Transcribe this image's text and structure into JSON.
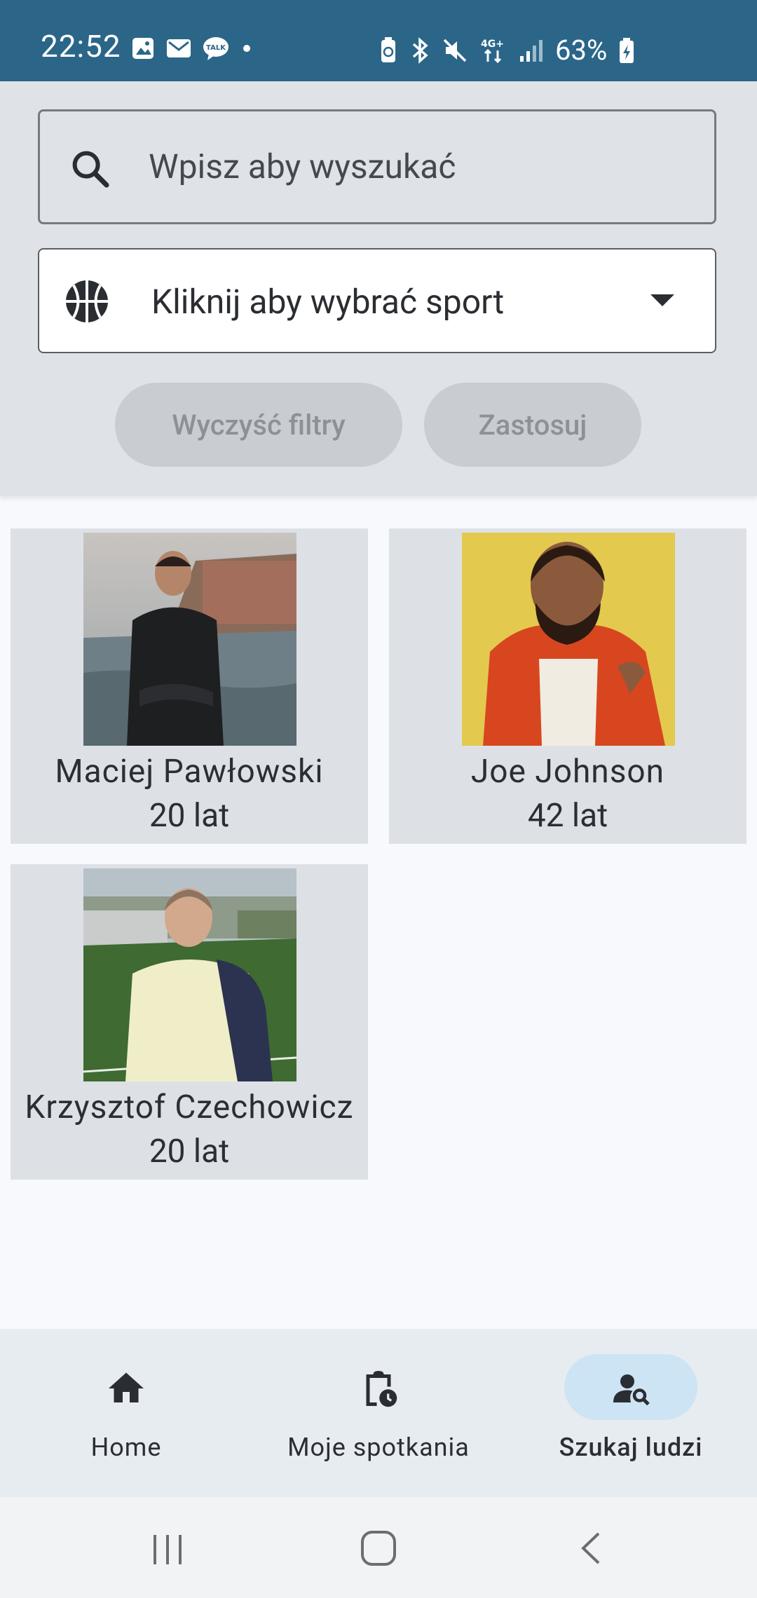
{
  "status_bar": {
    "time": "22:52",
    "battery": "63%",
    "network": "4G+"
  },
  "filters": {
    "search_placeholder": "Wpisz aby wyszukać",
    "sport_label": "Kliknij aby wybrać sport",
    "clear_button": "Wyczyść filtry",
    "apply_button": "Zastosuj"
  },
  "people": [
    {
      "name": "Maciej Pawłowski",
      "age": "20 lat"
    },
    {
      "name": "Joe Johnson",
      "age": "42 lat"
    },
    {
      "name": "Krzysztof Czechowicz",
      "age": "20 lat"
    }
  ],
  "nav": [
    {
      "label": "Home",
      "icon": "home-icon"
    },
    {
      "label": "Moje spotkania",
      "icon": "clipboard-clock-icon"
    },
    {
      "label": "Szukaj ludzi",
      "icon": "person-search-icon",
      "active": true
    }
  ],
  "colors": {
    "status_bar": "#2b6689",
    "filter_panel": "#dfe3e8",
    "card_bg": "#dde1e6",
    "nav_active": "#cde4f5"
  }
}
